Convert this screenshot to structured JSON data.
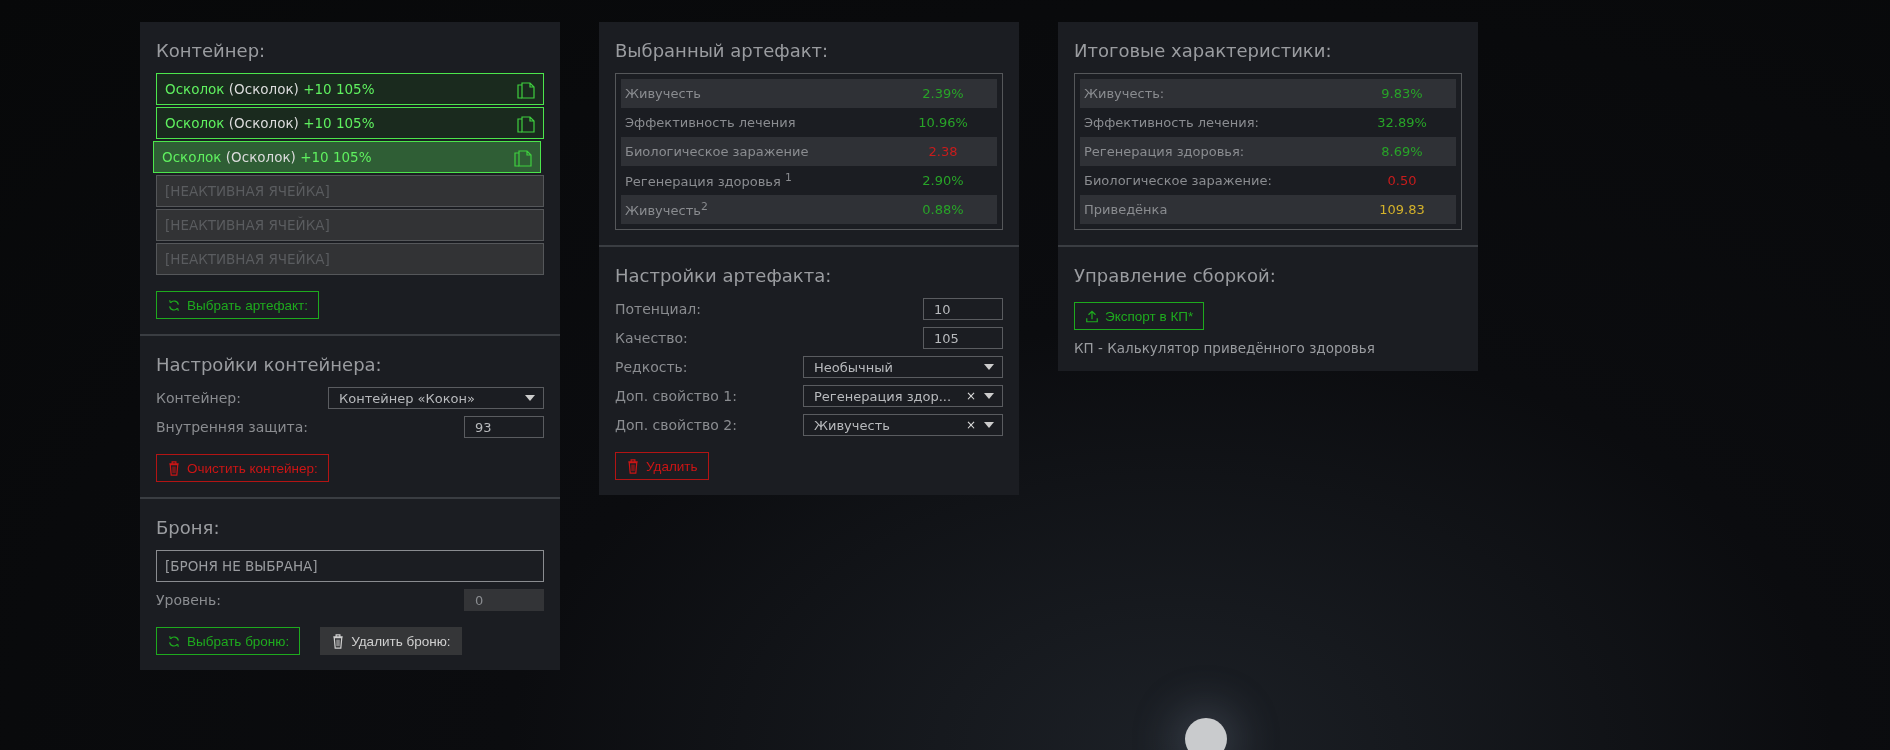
{
  "container_panel": {
    "title": "Контейнер:",
    "slots": [
      {
        "kind": "artifact",
        "selected": false,
        "name": "Осколок",
        "type": "(Осколок)",
        "bonus": "+10 105%"
      },
      {
        "kind": "artifact",
        "selected": false,
        "name": "Осколок",
        "type": "(Осколок)",
        "bonus": "+10 105%"
      },
      {
        "kind": "artifact",
        "selected": true,
        "name": "Осколок",
        "type": "(Осколок)",
        "bonus": "+10 105%"
      },
      {
        "kind": "inactive",
        "selected": false,
        "label": "[НЕАКТИВНАЯ ЯЧЕЙКА]"
      },
      {
        "kind": "inactive",
        "selected": false,
        "label": "[НЕАКТИВНАЯ ЯЧЕЙКА]"
      },
      {
        "kind": "inactive",
        "selected": false,
        "label": "[НЕАКТИВНАЯ ЯЧЕЙКА]"
      }
    ],
    "choose_button": {
      "label": "Выбрать артефакт:"
    },
    "settings_title": "Настройки контейнера:",
    "fields": [
      {
        "kind": "select",
        "label": "Контейнер:",
        "value": "Контейнер «Кокон»"
      },
      {
        "kind": "input",
        "label": "Внутренняя защита:",
        "value": "93",
        "disabled": false
      }
    ],
    "clear_button": {
      "label": "Очистить контейнер:"
    },
    "armor_title": "Броня:",
    "armor_slot": "[БРОНЯ НЕ ВЫБРАНА]",
    "armor_fields": [
      {
        "kind": "input",
        "label": "Уровень:",
        "value": "0",
        "disabled": true
      }
    ],
    "armor_buttons": [
      {
        "label": "Выбрать броню:"
      },
      {
        "label": "Удалить броню:"
      }
    ]
  },
  "artifact_panel": {
    "title": "Выбранный артефакт:",
    "stats": [
      {
        "name": "Живучесть",
        "value": "2.39%",
        "color": "#28a428"
      },
      {
        "name": "Эффективность лечения",
        "value": "10.96%",
        "color": "#28a428"
      },
      {
        "name": "Биологическое заражение",
        "value": "2.38",
        "color": "#c81c1c"
      },
      {
        "name": "Регенерация здоровья $^{1}$",
        "value": "2.90%",
        "color": "#28a428"
      },
      {
        "name": "Живучесть$^{2}$",
        "value": "0.88%",
        "color": "#28a428"
      }
    ],
    "settings_title": "Настройки артефакта:",
    "fields": [
      {
        "kind": "input",
        "label": "Потенциал:",
        "value": "10",
        "disabled": false
      },
      {
        "kind": "input",
        "label": "Качество:",
        "value": "105",
        "disabled": false
      },
      {
        "kind": "select",
        "label": "Редкость:",
        "value": "Необычный"
      },
      {
        "kind": "select",
        "label": "Доп. свойство 1:",
        "value": "Регенерация здор...",
        "clear": "×"
      },
      {
        "kind": "select",
        "label": "Доп. свойство 2:",
        "value": "Живучесть",
        "clear": "×"
      }
    ],
    "delete_button": {
      "label": "Удалить"
    }
  },
  "totals_panel": {
    "title": "Итоговые характеристики:",
    "stats": [
      {
        "name": "Живучесть:",
        "value": "9.83%",
        "color": "#28a428"
      },
      {
        "name": "Эффективность лечения:",
        "value": "32.89%",
        "color": "#28a428"
      },
      {
        "name": "Регенерация здоровья:",
        "value": "8.69%",
        "color": "#28a428"
      },
      {
        "name": "Биологическое заражение:",
        "value": "0.50",
        "color": "#c81c1c"
      },
      {
        "name": "Приведёнка",
        "value": "109.83",
        "color": "#d4b22a"
      }
    ],
    "build_title": "Управление сборкой:",
    "export_button": {
      "label": "Экспорт в КП*"
    },
    "footnote": "КП - Калькулятор приведённого здоровья"
  }
}
